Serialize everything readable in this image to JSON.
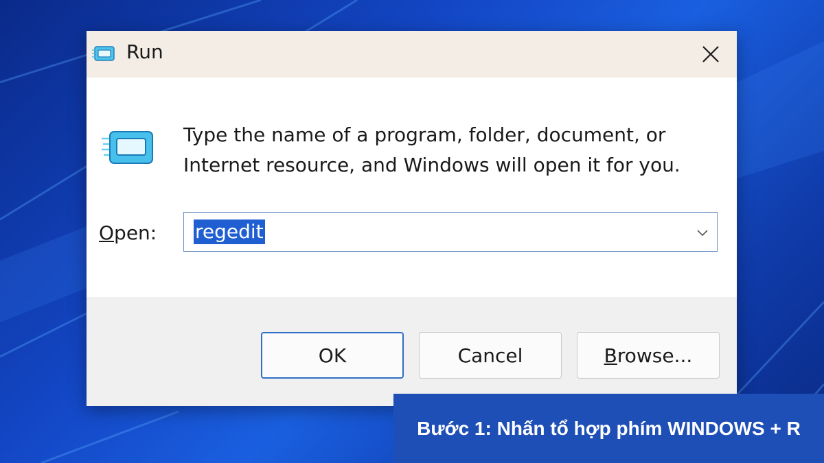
{
  "window": {
    "title": "Run",
    "title_icon": "run-icon",
    "close_icon": "close-icon"
  },
  "body": {
    "icon": "run-icon",
    "description": "Type the name of a program, folder, document, or Internet resource, and Windows will open it for you."
  },
  "open_field": {
    "label_access_key": "O",
    "label_rest": "pen:",
    "value": "regedit",
    "dropdown_icon": "chevron-down-icon"
  },
  "buttons": {
    "ok": "OK",
    "cancel": "Cancel",
    "browse_access_key": "B",
    "browse_rest": "rowse..."
  },
  "caption": {
    "text": "Bước 1: Nhấn tổ hợp phím WINDOWS + R"
  },
  "colors": {
    "accent": "#1f5fd1",
    "titlebar": "#f4ede6",
    "footer": "#f0f0f0",
    "caption_bg": "#1e4fb6"
  }
}
